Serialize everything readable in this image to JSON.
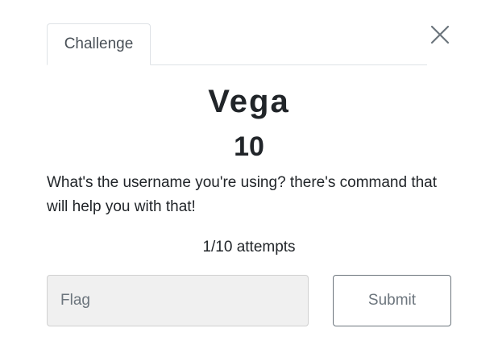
{
  "tabs": [
    {
      "label": "Challenge",
      "active": true
    }
  ],
  "challenge": {
    "name": "Vega",
    "points": "10",
    "description": "What's the username you're using? there's command that will help you with that!",
    "attempts": "1/10 attempts"
  },
  "form": {
    "flag_placeholder": "Flag",
    "flag_value": "",
    "submit_label": "Submit"
  },
  "icons": {
    "close": "close-icon"
  },
  "colors": {
    "text": "#212529",
    "muted": "#6c757d",
    "border": "#dee2e6",
    "input_bg": "#f0f0f0"
  }
}
